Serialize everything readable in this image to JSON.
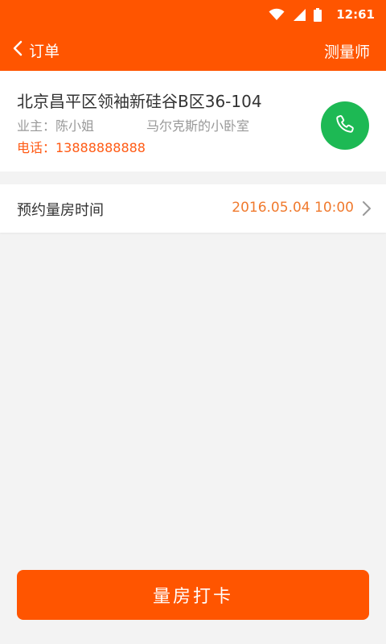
{
  "status_bar": {
    "time": "12:61"
  },
  "header": {
    "back_label": "订单",
    "role_label": "测量师"
  },
  "order": {
    "address": "北京昌平区领袖新硅谷B区36-104",
    "owner_label": "业主：",
    "owner_name": "陈小姐",
    "room_name": "马尔克斯的小卧室",
    "phone": "电话：13888888888"
  },
  "appointment": {
    "label": "预约量房时间",
    "time": "2016.05.04 10:00"
  },
  "actions": {
    "checkin_label": "量房打卡"
  },
  "icons": {
    "back": "chevron-left-icon",
    "call": "phone-icon",
    "appointment_arrow": "chevron-right-icon",
    "wifi": "wifi-icon",
    "signal": "signal-icon",
    "battery": "battery-icon"
  },
  "colors": {
    "brand": "#ff5500",
    "call_button": "#1db954",
    "accent_text": "#f07a2e",
    "background": "#f3f3f3"
  }
}
